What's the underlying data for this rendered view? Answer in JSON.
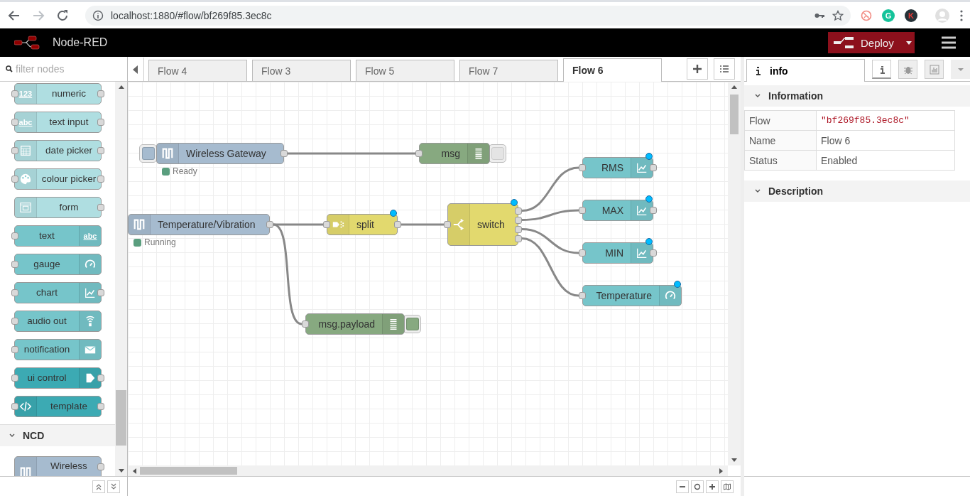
{
  "browser": {
    "url": "localhost:1880/#flow/bf269f85.3ec8c",
    "extensions": [
      {
        "kind": "icon",
        "color": "#f28b82"
      },
      {
        "kind": "letter",
        "label": "G",
        "color": "#15c39a"
      },
      {
        "kind": "letter",
        "label": "K",
        "color": "#263238"
      }
    ]
  },
  "header": {
    "title": "Node-RED",
    "deploy": "Deploy"
  },
  "palette": {
    "placeholder": "filter nodes",
    "nodes": [
      {
        "label": "numeric",
        "kind": "numeric",
        "icon_text": "123",
        "color": "#afdee1",
        "input": true,
        "output": true
      },
      {
        "label": "text input",
        "kind": "textinput",
        "icon_text": "abc",
        "color": "#afdee1",
        "input": true,
        "output": true
      },
      {
        "label": "date picker",
        "kind": "datepicker",
        "color": "#afdee1",
        "input": true,
        "output": true
      },
      {
        "label": "colour picker",
        "kind": "colourpicker",
        "color": "#afdee1",
        "input": true,
        "output": true
      },
      {
        "label": "form",
        "kind": "form",
        "color": "#afdee1",
        "input": false,
        "output": true
      },
      {
        "label": "text",
        "kind": "text",
        "icon_text": "abc",
        "color": "#76c5ca",
        "input": true,
        "output": false
      },
      {
        "label": "gauge",
        "kind": "gauge",
        "color": "#76c5ca",
        "input": true,
        "output": false
      },
      {
        "label": "chart",
        "kind": "chart",
        "color": "#76c5ca",
        "input": true,
        "output": true
      },
      {
        "label": "audio out",
        "kind": "audio",
        "color": "#76c5ca",
        "input": true,
        "output": false
      },
      {
        "label": "notification",
        "kind": "notification",
        "color": "#76c5ca",
        "input": true,
        "output": false
      },
      {
        "label": "ui control",
        "kind": "control",
        "color": "#3caab3",
        "input": true,
        "output": true
      },
      {
        "label": "template",
        "kind": "template",
        "color": "#3caab3",
        "input": true,
        "output": true
      }
    ],
    "categories": [
      {
        "label": "NCD",
        "expanded": true,
        "nodes": [
          {
            "label": "Wireless",
            "kind": "sensor",
            "color": "#a6bbcf",
            "input": false,
            "output": true
          }
        ]
      }
    ]
  },
  "tabs": [
    {
      "label": "Flow 4",
      "selected": false
    },
    {
      "label": "Flow 3",
      "selected": false
    },
    {
      "label": "Flow 5",
      "selected": false
    },
    {
      "label": "Flow 7",
      "selected": false
    },
    {
      "label": "Flow 6",
      "selected": true
    }
  ],
  "canvas": {
    "nodes": [
      {
        "label": "Wireless Gateway",
        "kind": "sensor",
        "color": "#a6bbcf",
        "input": false,
        "output": true,
        "changed": false,
        "status": {
          "text": "Ready",
          "color": "#5a9e7e"
        },
        "toggle": true,
        "toggle_on": true
      },
      {
        "label": "msg",
        "kind": "debug",
        "color": "#87a980",
        "input": true,
        "output": false,
        "changed": false,
        "toggle": true,
        "toggle_on": false
      },
      {
        "label": "Temperature/Vibration",
        "kind": "sensor",
        "color": "#a6bbcf",
        "input": false,
        "output": true,
        "changed": false,
        "status": {
          "text": "Running",
          "color": "#5a9e7e"
        },
        "toggle": false
      },
      {
        "label": "split",
        "kind": "split",
        "color": "#e2d96e",
        "input": true,
        "output": true,
        "changed": true,
        "toggle": false
      },
      {
        "label": "switch",
        "kind": "switch",
        "color": "#e2d96e",
        "input": true,
        "output": true,
        "changed": true,
        "toggle": false
      },
      {
        "label": "RMS",
        "kind": "chart",
        "color": "#76c5ca",
        "input": true,
        "output": true,
        "changed": true,
        "toggle": false
      },
      {
        "label": "MAX",
        "kind": "chart",
        "color": "#76c5ca",
        "input": true,
        "output": true,
        "changed": true,
        "toggle": false
      },
      {
        "label": "MIN",
        "kind": "chart",
        "color": "#76c5ca",
        "input": true,
        "output": true,
        "changed": true,
        "toggle": false
      },
      {
        "label": "Temperature",
        "kind": "gauge",
        "color": "#76c5ca",
        "input": true,
        "output": false,
        "changed": true,
        "toggle": false
      },
      {
        "label": "msg.payload",
        "kind": "debug",
        "color": "#87a980",
        "input": true,
        "output": false,
        "changed": false,
        "toggle": true,
        "toggle_on": true
      }
    ]
  },
  "sidebar": {
    "tabs": [
      {
        "label": "info",
        "selected": true
      }
    ],
    "tools": [
      {
        "kind": "info",
        "selected": true
      },
      {
        "kind": "debug",
        "selected": false
      },
      {
        "kind": "dashboard",
        "selected": false
      }
    ],
    "sections": [
      {
        "title": "Information",
        "expanded": true,
        "rows": [
          {
            "label": "Flow",
            "value": "\"bf269f85.3ec8c\"",
            "kind": "code"
          },
          {
            "label": "Name",
            "value": "Flow 6",
            "kind": "text"
          },
          {
            "label": "Status",
            "value": "Enabled",
            "kind": "text"
          }
        ]
      },
      {
        "title": "Description",
        "expanded": true
      }
    ]
  }
}
